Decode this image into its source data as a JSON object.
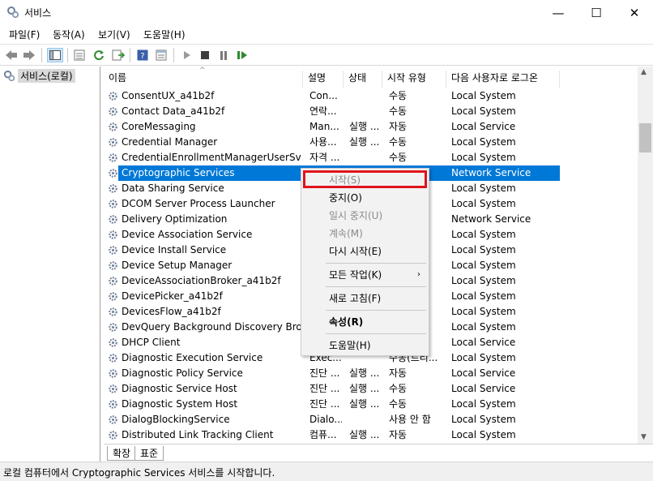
{
  "window": {
    "title": "서비스"
  },
  "window_controls": {
    "minimize": "—",
    "maximize": "☐",
    "close": "✕"
  },
  "menu": [
    "파일(F)",
    "동작(A)",
    "보기(V)",
    "도움말(H)"
  ],
  "tree": {
    "root": "서비스(로컬)"
  },
  "columns": [
    "이름",
    "설명",
    "상태",
    "시작 유형",
    "다음 사용자로 로그온"
  ],
  "sort_indicator": "^",
  "rows": [
    {
      "name": "ConsentUX_a41b2f",
      "desc": "Con...",
      "status": "",
      "startup": "수동",
      "logon": "Local System"
    },
    {
      "name": "Contact Data_a41b2f",
      "desc": "연락...",
      "status": "",
      "startup": "수동",
      "logon": "Local System"
    },
    {
      "name": "CoreMessaging",
      "desc": "Man...",
      "status": "실행 ...",
      "startup": "자동",
      "logon": "Local Service"
    },
    {
      "name": "Credential Manager",
      "desc": "사용...",
      "status": "실행 ...",
      "startup": "수동",
      "logon": "Local System"
    },
    {
      "name": "CredentialEnrollmentManagerUserSvc_a...",
      "desc": "자격 ...",
      "status": "",
      "startup": "수동",
      "logon": "Local System"
    },
    {
      "name": "Cryptographic Services",
      "desc": "",
      "status": "",
      "startup": "",
      "logon": "Network Service",
      "selected": true
    },
    {
      "name": "Data Sharing Service",
      "desc": "",
      "status": "",
      "startup": "",
      "logon": "Local System"
    },
    {
      "name": "DCOM Server Process Launcher",
      "desc": "",
      "status": "",
      "startup": "",
      "logon": "Local System"
    },
    {
      "name": "Delivery Optimization",
      "desc": "",
      "status": "",
      "startup": "",
      "logon": "Network Service"
    },
    {
      "name": "Device Association Service",
      "desc": "",
      "status": "",
      "startup": "",
      "logon": "Local System"
    },
    {
      "name": "Device Install Service",
      "desc": "",
      "status": "",
      "startup": "",
      "logon": "Local System"
    },
    {
      "name": "Device Setup Manager",
      "desc": "",
      "status": "",
      "startup": "",
      "logon": "Local System"
    },
    {
      "name": "DeviceAssociationBroker_a41b2f",
      "desc": "",
      "status": "",
      "startup": "",
      "logon": "Local System"
    },
    {
      "name": "DevicePicker_a41b2f",
      "desc": "",
      "status": "",
      "startup": "",
      "logon": "Local System"
    },
    {
      "name": "DevicesFlow_a41b2f",
      "desc": "",
      "status": "",
      "startup": "",
      "logon": "Local System"
    },
    {
      "name": "DevQuery Background Discovery Broker",
      "desc": "",
      "status": "",
      "startup": "",
      "logon": "Local System"
    },
    {
      "name": "DHCP Client",
      "desc": "",
      "status": "",
      "startup": "",
      "logon": "Local Service"
    },
    {
      "name": "Diagnostic Execution Service",
      "desc": "Exec...",
      "status": "",
      "startup": "수동(트리...",
      "logon": "Local System"
    },
    {
      "name": "Diagnostic Policy Service",
      "desc": "진단 ...",
      "status": "실행 ...",
      "startup": "자동",
      "logon": "Local Service"
    },
    {
      "name": "Diagnostic Service Host",
      "desc": "진단 ...",
      "status": "실행 ...",
      "startup": "수동",
      "logon": "Local Service"
    },
    {
      "name": "Diagnostic System Host",
      "desc": "진단 ...",
      "status": "실행 ...",
      "startup": "수동",
      "logon": "Local System"
    },
    {
      "name": "DialogBlockingService",
      "desc": "Dialo...",
      "status": "",
      "startup": "사용 안 함",
      "logon": "Local System"
    },
    {
      "name": "Distributed Link Tracking Client",
      "desc": "컴퓨...",
      "status": "실행 ...",
      "startup": "자동",
      "logon": "Local System"
    }
  ],
  "context_menu": {
    "start": "시작(S)",
    "stop": "중지(O)",
    "pause": "일시 중지(U)",
    "resume": "계속(M)",
    "restart": "다시 시작(E)",
    "all_tasks": "모든 작업(K)",
    "submenu_arrow": "›",
    "refresh": "새로 고침(F)",
    "properties": "속성(R)",
    "help": "도움말(H)"
  },
  "tabs": [
    "확장",
    "표준"
  ],
  "status_bar": "로컬 컴퓨터에서 Cryptographic Services 서비스를 시작합니다.",
  "colors": {
    "selection": "#0078d7",
    "highlight": "#e0141b",
    "menu_bg": "#f2f2f2"
  },
  "icons": [
    "services-gear-icon",
    "back-arrow-icon",
    "forward-arrow-icon",
    "play-icon",
    "stop-icon",
    "pause-icon",
    "resume-icon"
  ]
}
